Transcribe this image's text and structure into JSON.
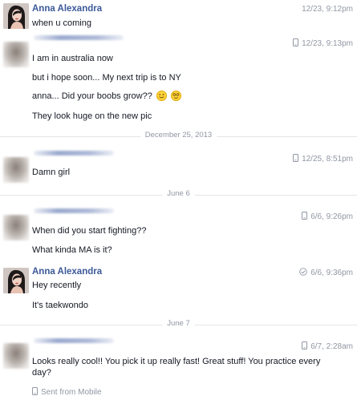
{
  "messages": [
    {
      "sender": "Anna Alexandra",
      "time": "12/23, 9:12pm",
      "lines": [
        "when u coming"
      ]
    },
    {
      "time": "12/23, 9:13pm",
      "lines": [
        "I am in australia now",
        "but i hope soon... My next trip is to NY",
        "anna... Did your boobs grow??",
        "They look huge on the new pic"
      ]
    },
    {
      "time": "12/25, 8:51pm",
      "lines": [
        "Damn girl"
      ]
    },
    {
      "time": "6/6, 9:26pm",
      "lines": [
        "When did you start fighting??",
        "What kinda MA is it?"
      ]
    },
    {
      "sender": "Anna Alexandra",
      "time": "6/6, 9:36pm",
      "lines": [
        "Hey recently",
        "It's taekwondo"
      ]
    },
    {
      "time": "6/7, 2:28am",
      "lines": [
        "Looks really cool!! You pick it up really fast! Great stuff! You practice every day?"
      ],
      "footer": "Sent from Mobile"
    }
  ],
  "dividers": [
    "December 25, 2013",
    "June 6",
    "June 7"
  ],
  "icons": {
    "mobile": "mobile-phone-icon",
    "check": "check-icon",
    "emoji": "smiley-emoji-icon"
  },
  "colors": {
    "name": "#3b5998",
    "meta": "#9197a3",
    "text": "#141823",
    "divider_line": "#e5e5e5"
  }
}
